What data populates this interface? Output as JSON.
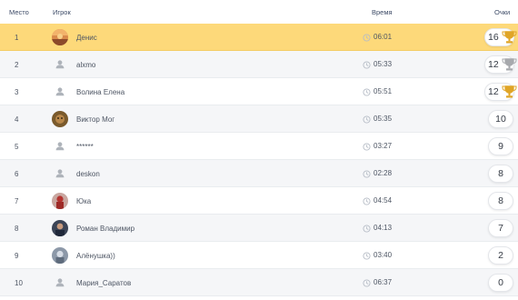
{
  "header": {
    "place": "Место",
    "player": "Игрок",
    "time": "Время",
    "score": "Очки"
  },
  "rows": [
    {
      "place": "1",
      "name": "Денис",
      "time": "06:01",
      "score": "16",
      "avatar": "photo-sunset",
      "cup": "gold-cup-icon",
      "highlight": true
    },
    {
      "place": "2",
      "name": "alxmo",
      "time": "05:33",
      "score": "12",
      "avatar": "user-placeholder-icon",
      "cup": "silver-cup-icon"
    },
    {
      "place": "3",
      "name": "Волина Елена",
      "time": "05:51",
      "score": "12",
      "avatar": "user-placeholder-icon",
      "cup": "gold-cup-icon"
    },
    {
      "place": "4",
      "name": "Виктор Мог",
      "time": "05:35",
      "score": "10",
      "avatar": "photo-brown"
    },
    {
      "place": "5",
      "name": "******",
      "time": "03:27",
      "score": "9",
      "avatar": "user-placeholder-icon"
    },
    {
      "place": "6",
      "name": "deskon",
      "time": "02:28",
      "score": "8",
      "avatar": "user-placeholder-icon"
    },
    {
      "place": "7",
      "name": "Юка",
      "time": "04:54",
      "score": "8",
      "avatar": "photo-red"
    },
    {
      "place": "8",
      "name": "Роман Владимир",
      "time": "04:13",
      "score": "7",
      "avatar": "photo-dark"
    },
    {
      "place": "9",
      "name": "Алёнушка))",
      "time": "03:40",
      "score": "2",
      "avatar": "photo-grey"
    },
    {
      "place": "10",
      "name": "Мария_Саратов",
      "time": "06:37",
      "score": "0",
      "avatar": "user-placeholder-icon"
    }
  ],
  "colors": {
    "highlight": "#fdd97a",
    "gold_cup": "#e0a526",
    "silver_cup": "#a7a9ad",
    "header_text": "#3c4a66"
  }
}
